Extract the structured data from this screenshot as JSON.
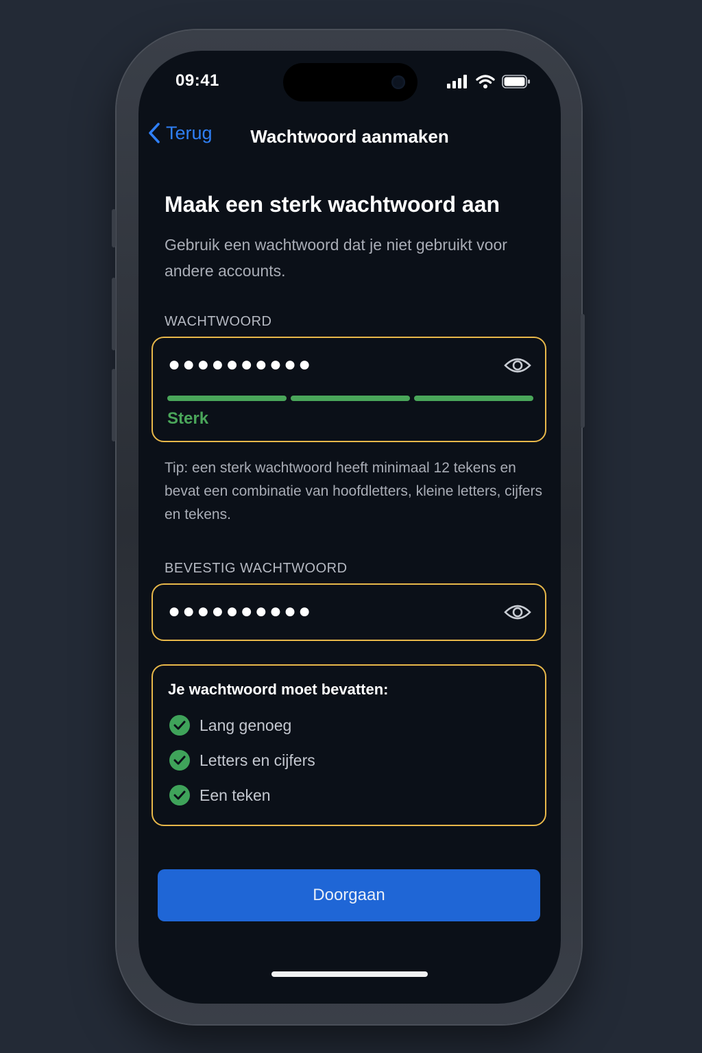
{
  "status_bar": {
    "time": "09:41"
  },
  "nav": {
    "back_label": "Terug",
    "title": "Wachtwoord aanmaken"
  },
  "content": {
    "heading": "Maak een sterk wachtwoord aan",
    "subtitle": "Gebruik een wachtwoord dat je niet gebruikt voor andere accounts."
  },
  "password": {
    "label": "WACHTWOORD",
    "masked_value": "●●●●●●●●●●",
    "strength_label": "Sterk",
    "strength_segments_filled": 3,
    "strength_segments_total": 3
  },
  "tip": "Tip: een sterk wachtwoord heeft minimaal 12 tekens en bevat een combinatie van hoofdletters, kleine letters, cijfers en tekens.",
  "confirm": {
    "label": "BEVESTIG WACHTWOORD",
    "masked_value": "●●●●●●●●●●"
  },
  "requirements": {
    "title": "Je wachtwoord moet bevatten:",
    "items": [
      {
        "label": "Lang genoeg",
        "met": true
      },
      {
        "label": "Letters en cijfers",
        "met": true
      },
      {
        "label": "Een teken",
        "met": true
      }
    ]
  },
  "cta": {
    "label": "Doorgaan"
  },
  "colors": {
    "accent": "#2f7ff5",
    "button": "#1f66d6",
    "field_border": "#e8b84a",
    "success": "#4aa65a",
    "background": "#0b1018"
  },
  "icons": [
    "chevron-left-icon",
    "signal-icon",
    "wifi-icon",
    "battery-icon",
    "eye-icon",
    "check-circle-icon"
  ]
}
